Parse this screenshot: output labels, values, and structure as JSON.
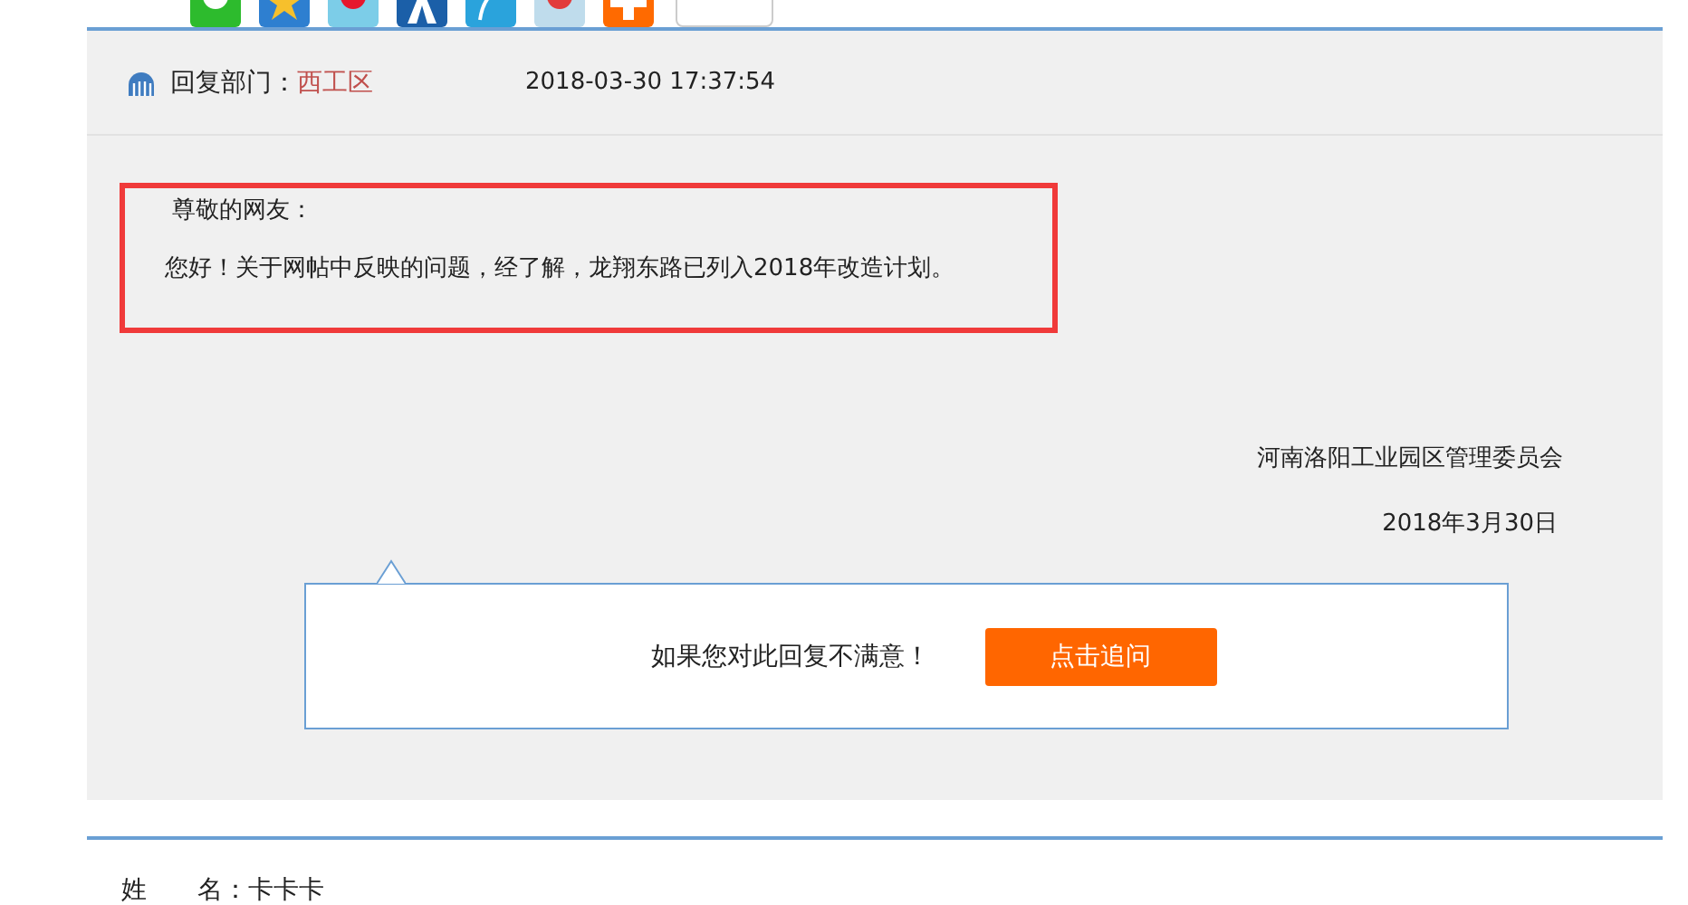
{
  "reply": {
    "department_label": "回复部门：",
    "department": "西工区",
    "time": "2018-03-30 17:37:54",
    "greeting": "尊敬的网友：",
    "body": "您好！关于网帖中反映的问题，经了解，龙翔东路已列入2018年改造计划。",
    "signature": "河南洛阳工业园区管理委员会",
    "date": "2018年3月30日"
  },
  "followup": {
    "prompt": "如果您对此回复不满意！",
    "button": "点击追问"
  },
  "form": {
    "fields": [
      {
        "label": "姓　　名：",
        "value": "卡卡卡"
      }
    ]
  }
}
